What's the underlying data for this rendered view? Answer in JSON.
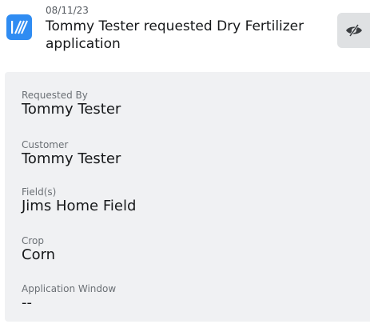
{
  "header": {
    "date": "08/11/23",
    "title": "Tommy Tester requested Dry Fertilizer application",
    "app_icon": "stripes-icon",
    "action_icon": "eye-slash-icon",
    "accent_color": "#2f8cf2"
  },
  "details": {
    "requested_by": {
      "label": "Requested By",
      "value": "Tommy Tester"
    },
    "customer": {
      "label": "Customer",
      "value": "Tommy Tester"
    },
    "fields": {
      "label": "Field(s)",
      "value": "Jims Home Field"
    },
    "crop": {
      "label": "Crop",
      "value": "Corn"
    },
    "application_window": {
      "label": "Application Window",
      "value": "--"
    }
  }
}
